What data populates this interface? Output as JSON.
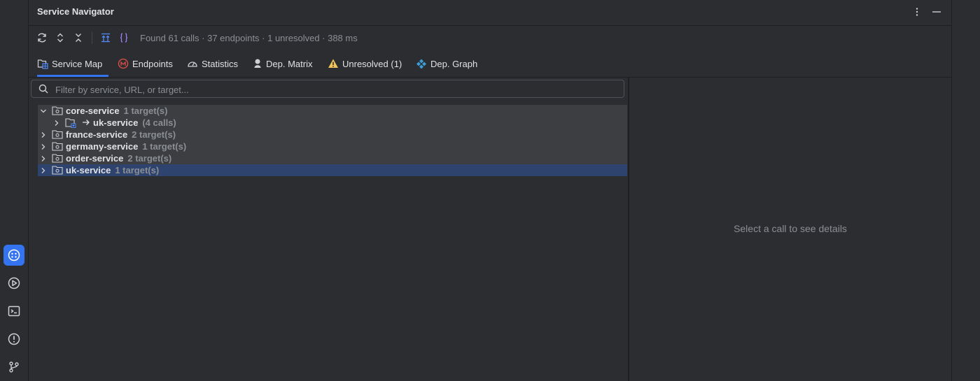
{
  "panel": {
    "title": "Service Navigator"
  },
  "toolbar": {
    "status": "Found 61 calls · 37 endpoints · 1 unresolved · 388 ms"
  },
  "tabs": [
    {
      "label": "Service Map",
      "icon": "service-map-icon",
      "active": true
    },
    {
      "label": "Endpoints",
      "icon": "endpoints-icon"
    },
    {
      "label": "Statistics",
      "icon": "gauge-icon"
    },
    {
      "label": "Dep. Matrix",
      "icon": "matrix-icon"
    },
    {
      "label": "Unresolved (1)",
      "icon": "warning-icon"
    },
    {
      "label": "Dep. Graph",
      "icon": "graph-icon"
    }
  ],
  "search": {
    "placeholder": "Filter by service, URL, or target..."
  },
  "tree": {
    "core": {
      "name": "core-service",
      "count": "1 target(s)"
    },
    "core_child": {
      "name": "uk-service",
      "count": "(4 calls)"
    },
    "france": {
      "name": "france-service",
      "count": "2 target(s)"
    },
    "germany": {
      "name": "germany-service",
      "count": "1 target(s)"
    },
    "order": {
      "name": "order-service",
      "count": "2 target(s)"
    },
    "uk": {
      "name": "uk-service",
      "count": "1 target(s)"
    }
  },
  "details": {
    "empty_message": "Select a call to see details"
  },
  "colors": {
    "accent": "#3574f0",
    "selection": "#2e436e",
    "warning": "#f2c55c",
    "endpoint_red": "#e5504a",
    "graph_blue": "#3d9bd6"
  }
}
